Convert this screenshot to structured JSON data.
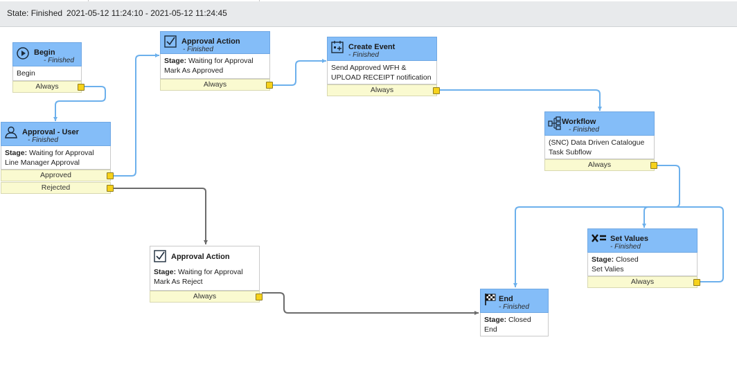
{
  "header": {
    "state": "State: Finished",
    "timestamp": "2021-05-12 11:24:10 - 2021-05-12 11:24:45"
  },
  "nodes": {
    "begin": {
      "title": "Begin",
      "status": "- Finished",
      "body": "Begin",
      "conditions": [
        "Always"
      ],
      "icon": "play-icon"
    },
    "approval_user": {
      "title": "Approval - User",
      "status": "- Finished",
      "stage_label": "Stage:",
      "stage_value": "Waiting for Approval",
      "line2": "Line Manager Approval",
      "conditions": [
        "Approved",
        "Rejected"
      ],
      "icon": "user-icon"
    },
    "approval_action_1": {
      "title": "Approval Action",
      "status": "- Finished",
      "stage_label": "Stage:",
      "stage_value": "Waiting for Approval",
      "line2": "Mark As Approved",
      "conditions": [
        "Always"
      ],
      "icon": "checkbox-icon"
    },
    "create_event": {
      "title": "Create Event",
      "status": "- Finished",
      "line1": "Send Approved WFH &",
      "line2": "UPLOAD RECEIPT notification",
      "conditions": [
        "Always"
      ],
      "icon": "calendar-icon"
    },
    "workflow": {
      "title": "Workflow",
      "status": "- Finished",
      "line1": "(SNC) Data Driven Catalogue",
      "line2": "Task Subflow",
      "conditions": [
        "Always"
      ],
      "icon": "subflow-icon"
    },
    "approval_action_2": {
      "title": "Approval Action",
      "stage_label": "Stage:",
      "stage_value": "Waiting for Approval",
      "line2": "Mark As Reject",
      "conditions": [
        "Always"
      ],
      "icon": "checkbox-icon"
    },
    "set_values": {
      "title": "Set Values",
      "status": "- Finished",
      "stage_label": "Stage:",
      "stage_value": "Closed",
      "line2": "Set Valies",
      "conditions": [
        "Always"
      ],
      "icon": "x-equals-icon"
    },
    "end": {
      "title": "End",
      "status": "- Finished",
      "stage_label": "Stage:",
      "stage_value": "Closed",
      "line2": "End",
      "icon": "checkered-flag-icon"
    }
  },
  "colors": {
    "node_header": "#84bdf8",
    "condition_bg": "#fafad0",
    "port": "#f6d21b",
    "active_connector": "#6cb0ec",
    "inactive_connector": "#6b6b6b"
  }
}
